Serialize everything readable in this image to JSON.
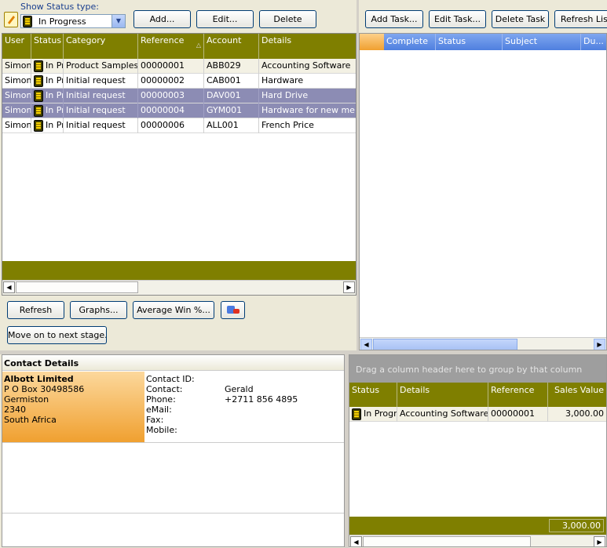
{
  "status_filter": {
    "label": "Show Status type:",
    "selected": "In Progress"
  },
  "top_buttons": {
    "add": "Add...",
    "edit": "Edit...",
    "delete": "Delete"
  },
  "task_buttons": {
    "add_task": "Add Task...",
    "edit_task": "Edit Task...",
    "delete_task": "Delete Task",
    "refresh": "Refresh List"
  },
  "grid": {
    "columns": [
      "User",
      "Status",
      "Category",
      "Reference",
      "Account",
      "Details"
    ],
    "rows": [
      {
        "user": "Simon",
        "status": "In Progress",
        "category": "Product Samples sent",
        "reference": "00000001",
        "account": "ABB029",
        "details": "Accounting Software",
        "state": "first"
      },
      {
        "user": "Simon",
        "status": "In Progress",
        "category": "Initial request",
        "reference": "00000002",
        "account": "CAB001",
        "details": "Hardware",
        "state": "normal"
      },
      {
        "user": "Simon",
        "status": "In Progress",
        "category": "Initial request",
        "reference": "00000003",
        "account": "DAV001",
        "details": "Hard Drive",
        "state": "selected"
      },
      {
        "user": "Simon",
        "status": "In Progress",
        "category": "Initial request",
        "reference": "00000004",
        "account": "GYM001",
        "details": "Hardware for new members",
        "state": "selected"
      },
      {
        "user": "Simon",
        "status": "In Progress",
        "category": "Initial request",
        "reference": "00000006",
        "account": "ALL001",
        "details": "French Price",
        "state": "normal"
      }
    ]
  },
  "bottom_buttons": {
    "refresh": "Refresh",
    "graphs": "Graphs...",
    "avg_win": "Average Win %...",
    "next_stage": "Move on to next stage..."
  },
  "tasks_grid": {
    "columns": [
      "Complete",
      "Status",
      "Subject",
      "Du..."
    ]
  },
  "contact": {
    "section_title": "Contact Details",
    "company": "Albott Limited",
    "address": [
      "P O Box 30498586",
      "Germiston",
      "2340",
      "South Africa"
    ],
    "fields": [
      {
        "label": "Contact ID:",
        "value": ""
      },
      {
        "label": "Contact:",
        "value": "Gerald"
      },
      {
        "label": "Phone:",
        "value": "+2711 856 4895"
      },
      {
        "label": "eMail:",
        "value": ""
      },
      {
        "label": "Fax:",
        "value": ""
      },
      {
        "label": "Mobile:",
        "value": ""
      }
    ]
  },
  "sales_grid": {
    "group_hint": "Drag a column header here to group by that column",
    "columns": [
      "Status",
      "Details",
      "Reference",
      "Sales Value"
    ],
    "rows": [
      {
        "status": "In Progress",
        "details": "Accounting Software",
        "reference": "00000001",
        "value": "3,000.00"
      }
    ],
    "total": "3,000.00"
  }
}
